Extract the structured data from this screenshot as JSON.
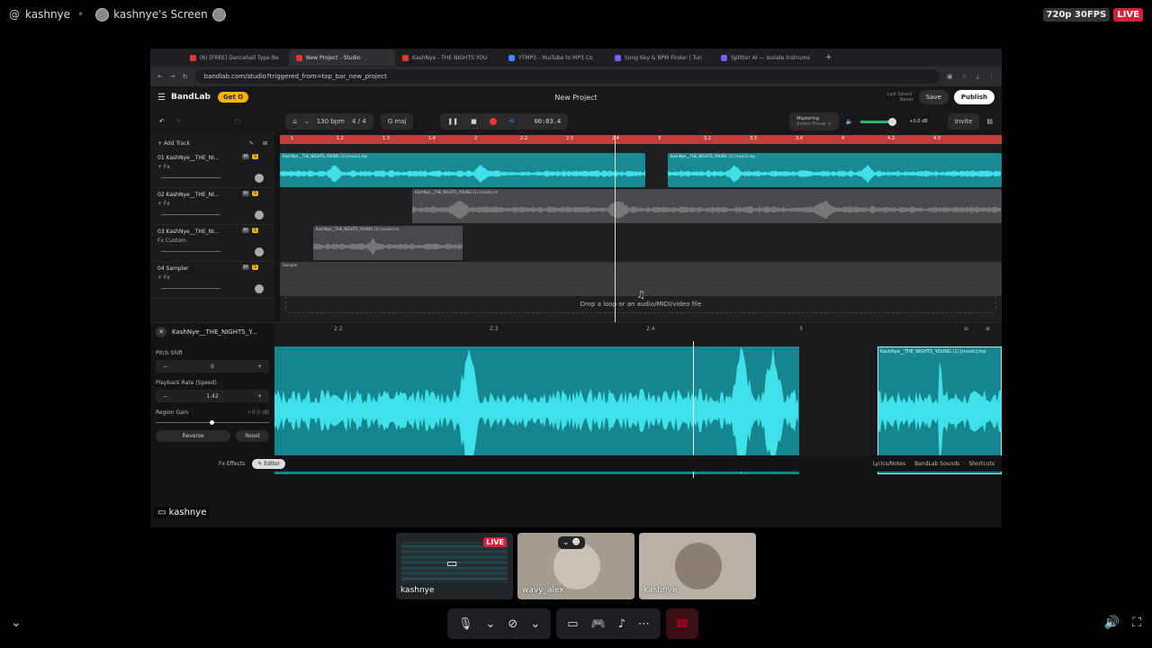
{
  "topbar": {
    "user": "kashnye",
    "screen_label": "kashnye's Screen",
    "quality": "720p 30FPS",
    "live": "LIVE"
  },
  "browser": {
    "tabs": [
      {
        "label": "(6) [FREE] Dancehall Type Be",
        "color": "#e33"
      },
      {
        "label": "New Project - Studio",
        "color": "#e33",
        "active": true
      },
      {
        "label": "KashNye - THE NIGHTS YOU",
        "color": "#e33"
      },
      {
        "label": "YTMP3 - YouTube to MP3 Co",
        "color": "#3a8cff"
      },
      {
        "label": "Song Key & BPM Finder | Tun",
        "color": "#7a5cff"
      },
      {
        "label": "Splitter AI — Isolate Instrume",
        "color": "#7a5cff"
      }
    ],
    "url": "bandlab.com/studio?triggered_from=top_bar_new_project"
  },
  "app": {
    "logo": "BandLab",
    "get_label": "Get ✪",
    "project_title": "New Project",
    "last_saved_label": "Last Saved:",
    "last_saved_value": "Never",
    "save_label": "Save",
    "publish_label": "Publish",
    "invite_label": "Invite"
  },
  "transport": {
    "bpm": "130 bpm",
    "signature": "4 / 4",
    "key": "G maj",
    "time": "00:03.4",
    "mastering_label": "Mastering",
    "mastering_sub": "Select Preset >",
    "volume": "+0.0 dB"
  },
  "arrange": {
    "add_track_label": "+ Add Track",
    "tracks": [
      {
        "name": "01  KashNye__THE_NI...",
        "fx": "+ Fx"
      },
      {
        "name": "02  KashNye__THE_NI...",
        "fx": "+ Fx"
      },
      {
        "name": "03  KashNye__THE_NI...",
        "fx": "Fx Custom"
      },
      {
        "name": "04  Sampler",
        "fx": "+ Fx"
      }
    ],
    "clip_label_1": "KashNye__THE_NIGHTS_YOUNG (1) [music].mp",
    "clip_label_2": "KashNye__THE_NIGHTS_YOUNG (1) [music].mp",
    "clip_label_3": "KashNye__THE_NIGHTS_YOUNG (1) (vocals).m",
    "clip_label_4": "KashNye__THE_NIGHTS_YOUNG (1) (vocals).m",
    "clip_label_5": "Sampler",
    "ruler": [
      "1",
      "1.2",
      "1.3",
      "1.4",
      "2",
      "2.2",
      "2.3",
      "2.4",
      "3",
      "3.2",
      "3.3",
      "3.4",
      "4",
      "4.2",
      "4.3"
    ],
    "dropzone": "Drop a loop or an audio/MIDI/video file"
  },
  "editor": {
    "region_name": "KashNye__THE_NIGHTS_Y...",
    "pitch_label": "Pitch Shift",
    "pitch_value": "0",
    "rate_label": "Playback Rate (Speed)",
    "rate_value": "1.42",
    "gain_label": "Region Gain",
    "gain_value": "+0.0 dB",
    "reverse_label": "Reverse",
    "reset_label": "Reset",
    "ruler": [
      "2.2",
      "2.3",
      "2.4",
      "3"
    ],
    "clip_label": "KashNye__THE_NIGHTS_YOUNG (1) [music].mp",
    "tab_effects": "Fx  Effects",
    "tab_editor": "✎  Editor",
    "lyrics": "Lyrics/Notes",
    "sounds": "BandLab Sounds",
    "shortcuts": "Shortcuts"
  },
  "stream_caption": "kashnye",
  "participants": [
    {
      "name": "kashnye",
      "live": "LIVE"
    },
    {
      "name": "wavy_alex"
    },
    {
      "name": "kashnye"
    }
  ]
}
